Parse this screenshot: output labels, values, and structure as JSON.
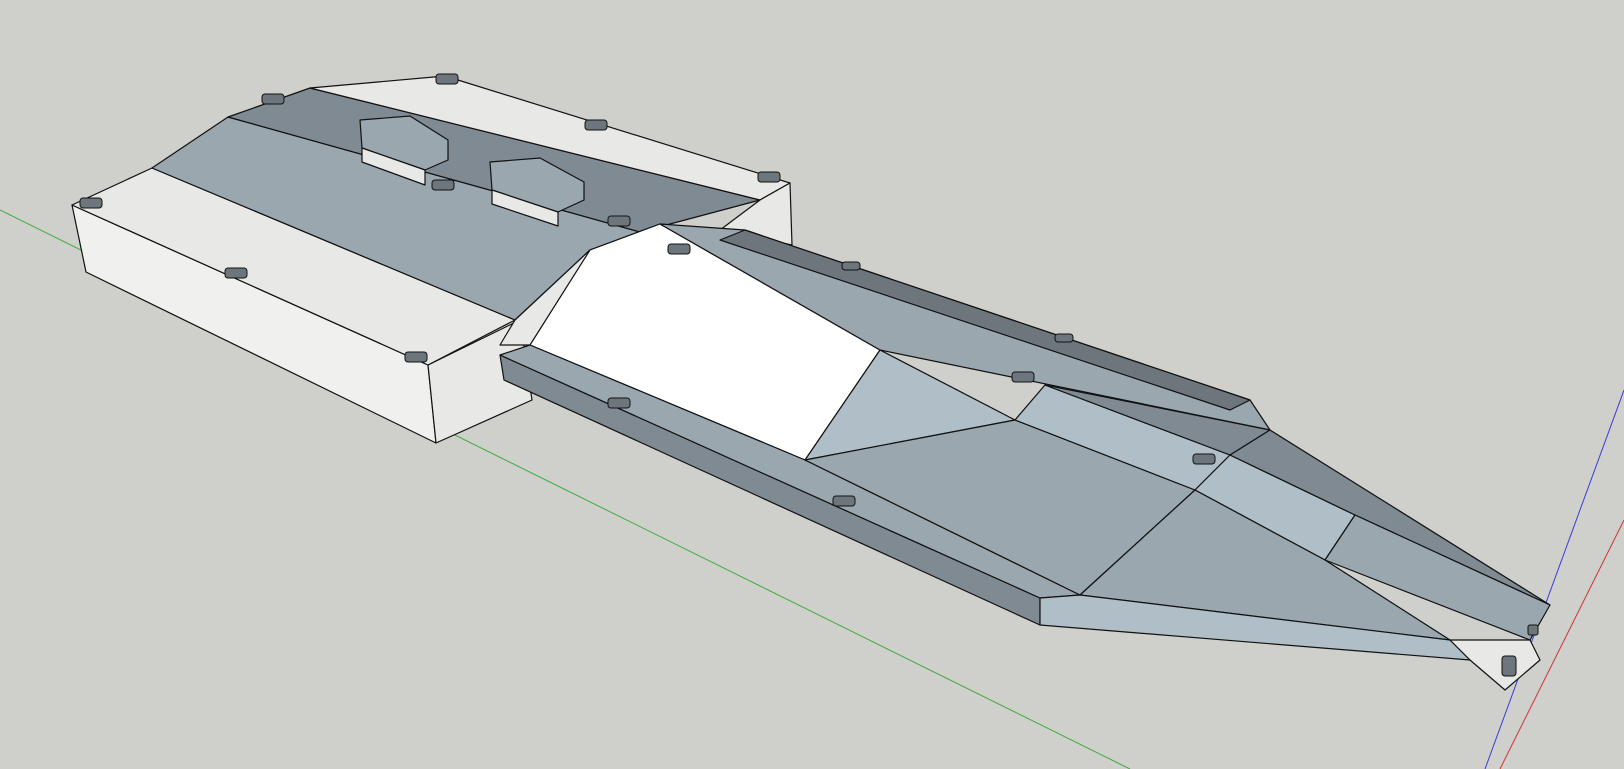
{
  "app": {
    "view": "3d-model-viewport",
    "background_color": "#cfd0cb"
  },
  "axes": {
    "green_axis_color": "#3faa3f",
    "red_axis_color": "#d83030",
    "blue_axis_color": "#3a3ad8"
  },
  "model": {
    "edge_color": "#111111",
    "face_colors": {
      "light": "#e8e8e6",
      "light_side": "#f0f0ef",
      "mid": "#9aa7af",
      "steel": "#b0bfc7",
      "dark": "#7f8a92",
      "darker": "#6d767d",
      "white": "#ffffff"
    }
  }
}
